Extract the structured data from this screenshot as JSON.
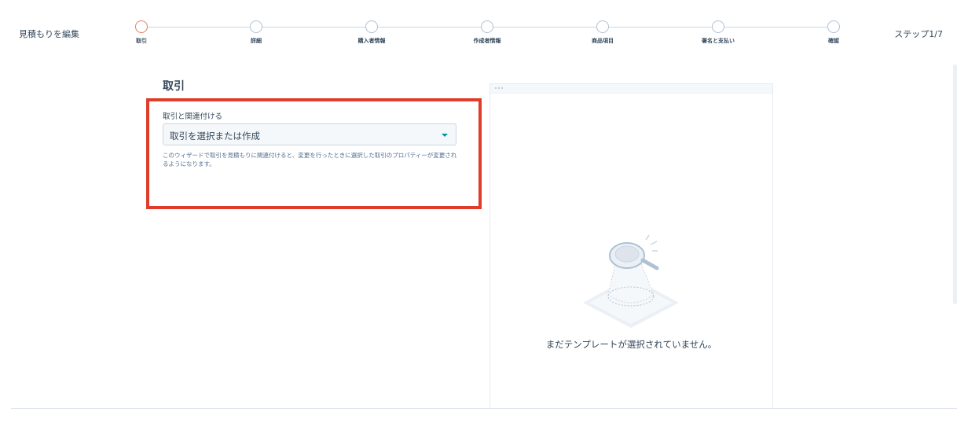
{
  "header": {
    "title": "見積もりを編集",
    "step_counter": "ステップ1/7"
  },
  "stepper": {
    "steps": [
      {
        "label": "取引",
        "state": "active"
      },
      {
        "label": "詳細",
        "state": "pending"
      },
      {
        "label": "購入者情報",
        "state": "pending"
      },
      {
        "label": "作成者情報",
        "state": "pending"
      },
      {
        "label": "商品項目",
        "state": "pending"
      },
      {
        "label": "署名と支払い",
        "state": "pending"
      },
      {
        "label": "確認",
        "state": "pending"
      }
    ],
    "active_color": "#ea7c58"
  },
  "form": {
    "section_title": "取引",
    "field_label": "取引と関連付ける",
    "select_value": "取引を選択または作成",
    "help_text": "このウィザードで取引を見積もりに関連付けると、変更を行ったときに選択した取引のプロパティーが変更されるようになります。"
  },
  "preview": {
    "empty_message": "まだテンプレートが選択されていません。",
    "illustration_icon": "magnifier-empty-icon"
  },
  "colors": {
    "highlight": "#e03c2a",
    "accent": "#0091ae"
  }
}
